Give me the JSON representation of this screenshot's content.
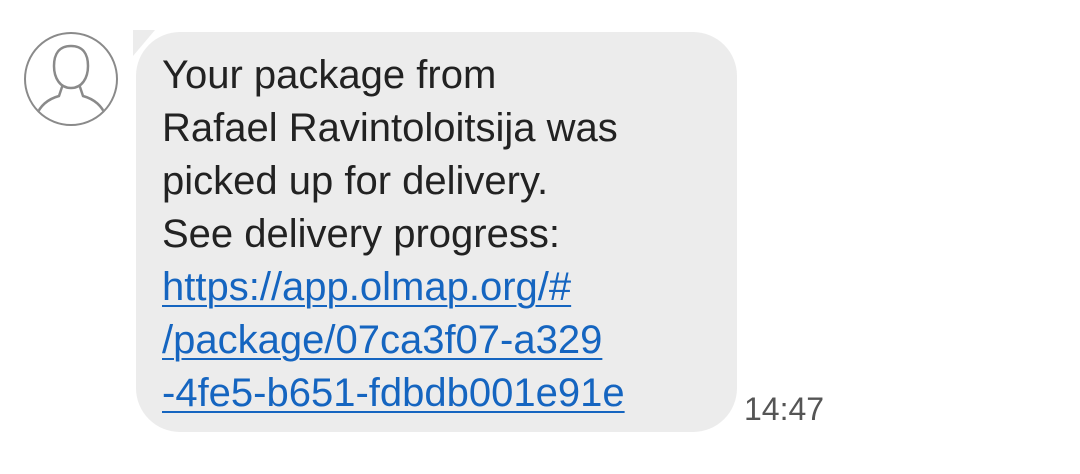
{
  "contact": {
    "avatar_icon": "person-outline-icon"
  },
  "message": {
    "text_lines": [
      "Your package from",
      "Rafael Ravintoloitsija was",
      "picked up for delivery.",
      "See delivery progress:"
    ],
    "link_lines": [
      "https://app.olmap.org/#",
      "/package/07ca3f07-a329",
      "-4fe5-b651-fdbdb001e91e"
    ],
    "time": "14:47"
  },
  "colors": {
    "bubble_background": "#ececec",
    "link": "#1565c0",
    "text": "#222222",
    "time": "#555555",
    "avatar_outline": "#8a8a8a"
  }
}
